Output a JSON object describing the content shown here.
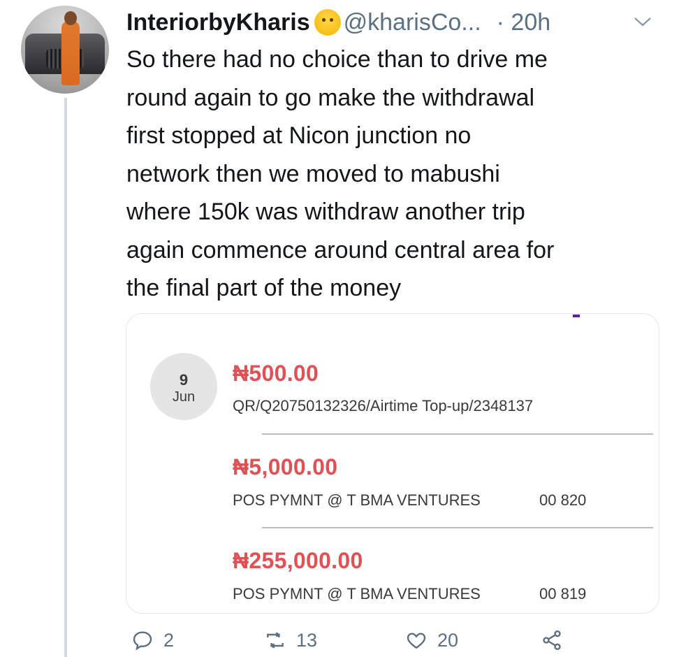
{
  "tweet": {
    "display_name": "InteriorbyKharis",
    "handle": "@kharisCo...",
    "time": "· 20h",
    "text": "So there had no choice than to drive me\nround again to go make the withdrawal\nfirst stopped at Nicon junction no\nnetwork then we moved to mabushi\nwhere 150k was withdraw another trip\nagain commence around central area for\nthe final part of the money"
  },
  "card": {
    "date_day": "9",
    "date_month": "Jun",
    "transactions": [
      {
        "amount": "₦500.00",
        "description": "QR/Q20750132326/Airtime Top-up/2348137",
        "ref": ""
      },
      {
        "amount": "₦5,000.00",
        "description": "POS PYMNT @ T BMA VENTURES",
        "ref": "00 820"
      },
      {
        "amount": "₦255,000.00",
        "description": "POS PYMNT @ T BMA VENTURES",
        "ref": "00 819"
      }
    ]
  },
  "actions": {
    "reply_count": "2",
    "retweet_count": "13",
    "like_count": "20"
  },
  "colors": {
    "amount": "#e05055",
    "muted": "#5b7083",
    "thread_line": "#d3dbe2"
  }
}
